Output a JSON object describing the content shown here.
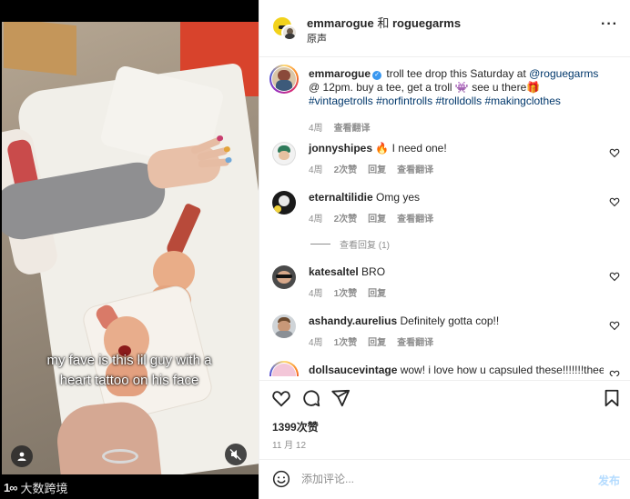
{
  "video": {
    "captions": [
      "my fave is this lil guy with a",
      "heart tattoo on his face"
    ],
    "watermark_logo": "1∞",
    "watermark_text": "大数跨境"
  },
  "header": {
    "account1": "emmarogue",
    "joiner": "和",
    "account2": "roguegarms",
    "subtitle": "原声",
    "more": "···"
  },
  "caption": {
    "username": "emmarogue",
    "text_1": "troll tee drop this Saturday at ",
    "mention": "@roguegarms",
    "text_2": " @ 12pm. buy a tee, get a troll 👾 see u there🎁 ",
    "tag1": "#vintagetrolls",
    "tag2": "#norfintrolls",
    "tag3": "#trolldolls",
    "tag4": "#makingclothes",
    "time": "4周",
    "translate": "查看翻译"
  },
  "comments": [
    {
      "username": "jonnyshipes",
      "text": "🔥 I need one!",
      "time": "4周",
      "likes": "2次赞",
      "reply": "回复",
      "translate": "查看翻译"
    },
    {
      "username": "eternaltilidie",
      "text": "Omg yes",
      "time": "4周",
      "likes": "2次赞",
      "reply": "回复",
      "translate": "查看翻译",
      "view_replies": "查看回复 (1)"
    },
    {
      "username": "katesaltel",
      "text": "BRO",
      "time": "4周",
      "likes": "1次赞",
      "reply": "回复"
    },
    {
      "username": "ashandy.aurelius",
      "text": "Definitely gotta cop!!",
      "time": "4周",
      "likes": "1次赞",
      "reply": "回复",
      "translate": "查看翻译"
    },
    {
      "username": "dollsaucevintage",
      "text": "wow! i love how u capsuled these!!!!!!!theese"
    }
  ],
  "actions": {
    "likes": "1399次赞",
    "date": "11 月 12"
  },
  "composer": {
    "placeholder": "添加评论...",
    "post": "发布"
  }
}
